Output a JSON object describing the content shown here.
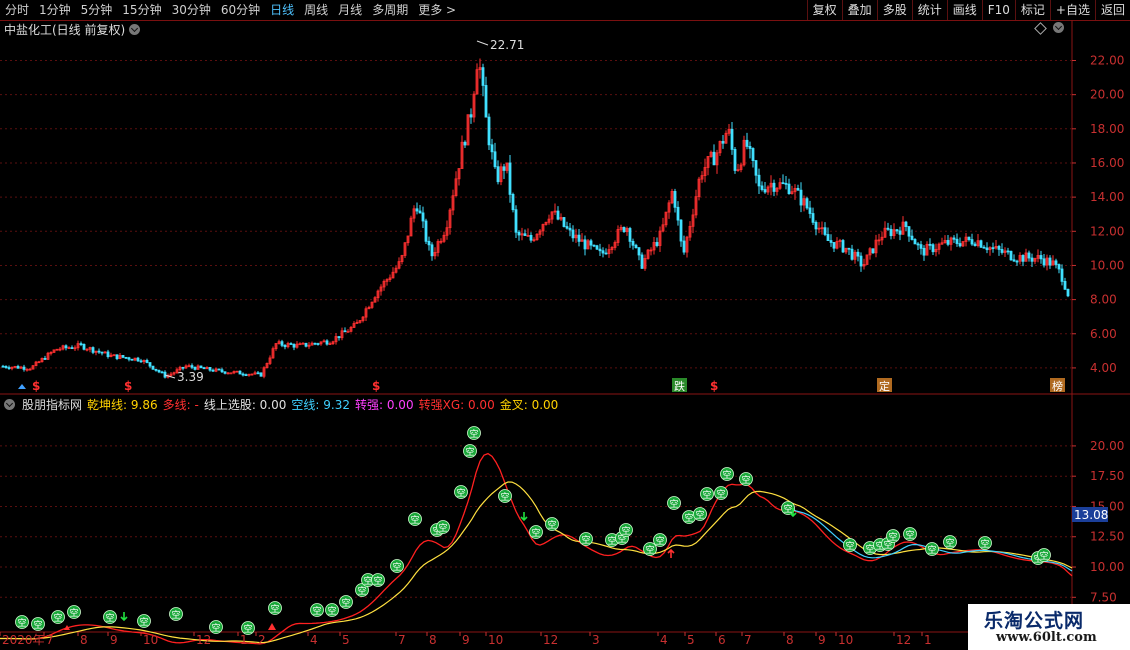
{
  "toolbar": {
    "tabs": [
      "分时",
      "1分钟",
      "5分钟",
      "15分钟",
      "30分钟",
      "60分钟",
      "日线",
      "周线",
      "月线",
      "多周期",
      "更多 >"
    ],
    "active_tab": "日线",
    "right_buttons": [
      "复权",
      "叠加",
      "多股",
      "统计",
      "画线",
      "F10",
      "标记",
      "+自选",
      "返回"
    ]
  },
  "title": "中盐化工(日线 前复权)",
  "price_chart": {
    "y_ticks": [
      "22.00",
      "20.00",
      "18.00",
      "16.00",
      "14.00",
      "12.00",
      "10.00",
      "8.00",
      "6.00",
      "4.00"
    ],
    "y_values": [
      22,
      20,
      18,
      16,
      14,
      12,
      10,
      8,
      6,
      4
    ],
    "ylim": [
      3.0,
      23.2
    ],
    "high_label": "22.71",
    "low_label": "3.39",
    "markers": [
      "$",
      "$",
      "$",
      "跌",
      "$",
      "定",
      "榜"
    ]
  },
  "indicator": {
    "name": "股朋指标网",
    "items": [
      {
        "label": "乾坤线:",
        "value": "9.86",
        "color": "#ffd200"
      },
      {
        "label": "多线:",
        "value": "-",
        "color": "#ff3030"
      },
      {
        "label": "线上选股:",
        "value": "0.00",
        "color": "#e0e0e0"
      },
      {
        "label": "空线:",
        "value": "9.32",
        "color": "#40d0ff"
      },
      {
        "label": "转强:",
        "value": "0.00",
        "color": "#ff40ff"
      },
      {
        "label": "转强XG:",
        "value": "0.00",
        "color": "#ff3030"
      },
      {
        "label": "金叉:",
        "value": "0.00",
        "color": "#ffd200"
      }
    ],
    "y_ticks": [
      "20.00",
      "17.50",
      "15.00",
      "12.50",
      "10.00",
      "7.50"
    ],
    "y_values": [
      20,
      17.5,
      15,
      12.5,
      10,
      7.5
    ],
    "ylim": [
      4.8,
      22.8
    ],
    "current_value": "13.08",
    "signal_glyph": "空"
  },
  "x_axis": {
    "labels": [
      "2020年",
      "7",
      "8",
      "9",
      "10",
      "12",
      "1",
      "2",
      "4",
      "5",
      "7",
      "8",
      "9",
      "10",
      "12",
      "3",
      "4",
      "5",
      "6",
      "7",
      "8",
      "9",
      "10",
      "12",
      "1"
    ]
  },
  "watermark": {
    "line1": "乐淘公式网",
    "line2": "www.60lt.com"
  },
  "colors": {
    "up": "#ff3030",
    "down": "#40e0ff",
    "grid": "#5a0f0f",
    "axis": "#c83030"
  }
}
